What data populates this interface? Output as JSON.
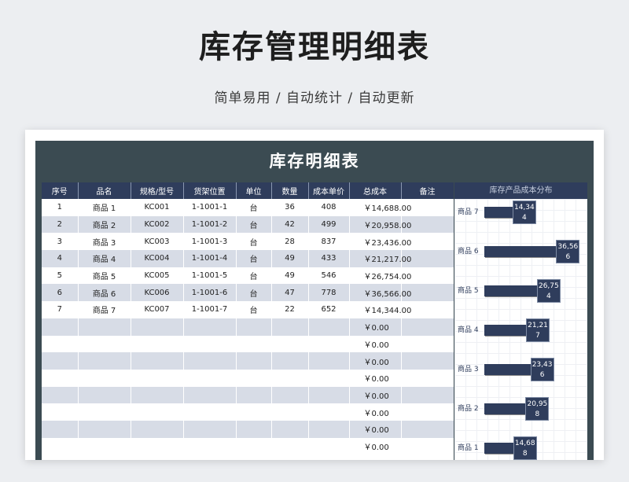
{
  "page": {
    "title": "库存管理明细表",
    "subtitle": "简单易用 / 自动统计 / 自动更新"
  },
  "sheet": {
    "title": "库存明细表",
    "headers": [
      "序号",
      "品名",
      "规格/型号",
      "货架位置",
      "单位",
      "数量",
      "成本单价",
      "总成本",
      "备注"
    ],
    "rows": [
      [
        "1",
        "商品 1",
        "KC001",
        "1-1001-1",
        "台",
        "36",
        "408",
        "￥14,688.00",
        ""
      ],
      [
        "2",
        "商品 2",
        "KC002",
        "1-1001-2",
        "台",
        "42",
        "499",
        "￥20,958.00",
        ""
      ],
      [
        "3",
        "商品 3",
        "KC003",
        "1-1001-3",
        "台",
        "28",
        "837",
        "￥23,436.00",
        ""
      ],
      [
        "4",
        "商品 4",
        "KC004",
        "1-1001-4",
        "台",
        "49",
        "433",
        "￥21,217.00",
        ""
      ],
      [
        "5",
        "商品 5",
        "KC005",
        "1-1001-5",
        "台",
        "49",
        "546",
        "￥26,754.00",
        ""
      ],
      [
        "6",
        "商品 6",
        "KC006",
        "1-1001-6",
        "台",
        "47",
        "778",
        "￥36,566.00",
        ""
      ],
      [
        "7",
        "商品 7",
        "KC007",
        "1-1001-7",
        "台",
        "22",
        "652",
        "￥14,344.00",
        ""
      ],
      [
        "",
        "",
        "",
        "",
        "",
        "",
        "",
        "￥0.00",
        ""
      ],
      [
        "",
        "",
        "",
        "",
        "",
        "",
        "",
        "￥0.00",
        ""
      ],
      [
        "",
        "",
        "",
        "",
        "",
        "",
        "",
        "￥0.00",
        ""
      ],
      [
        "",
        "",
        "",
        "",
        "",
        "",
        "",
        "￥0.00",
        ""
      ],
      [
        "",
        "",
        "",
        "",
        "",
        "",
        "",
        "￥0.00",
        ""
      ],
      [
        "",
        "",
        "",
        "",
        "",
        "",
        "",
        "￥0.00",
        ""
      ],
      [
        "",
        "",
        "",
        "",
        "",
        "",
        "",
        "￥0.00",
        ""
      ],
      [
        "",
        "",
        "",
        "",
        "",
        "",
        "",
        "￥0.00",
        ""
      ]
    ]
  },
  "colors": {
    "header": "#2f3d5c",
    "frame": "#3b4b52",
    "stripe": "#d7dce6"
  },
  "chart_data": {
    "type": "bar",
    "orientation": "horizontal",
    "title": "库存产品成本分布",
    "categories": [
      "商品 7",
      "商品 6",
      "商品 5",
      "商品 4",
      "商品 3",
      "商品 2",
      "商品 1"
    ],
    "values": [
      14344,
      36566,
      26754,
      21217,
      23436,
      20958,
      14688
    ],
    "value_labels": [
      "14,344",
      "36,566",
      "26,754",
      "21,217",
      "23,436",
      "20,958",
      "14,688"
    ],
    "xlim": [
      0,
      40000
    ],
    "grid": true
  }
}
